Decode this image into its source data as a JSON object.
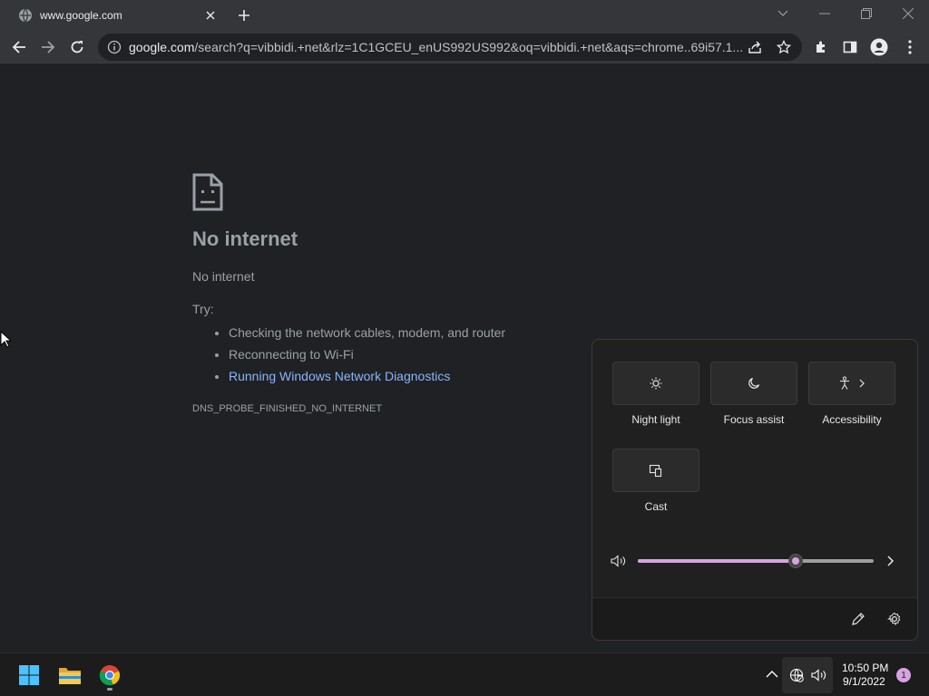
{
  "browser": {
    "tab": {
      "title": "www.google.com"
    },
    "address": {
      "host": "google.com",
      "path": "/search?q=vibbidi.+net&rlz=1C1GCEU_enUS992US992&oq=vibbidi.+net&aqs=chrome..69i57.1..."
    }
  },
  "error_page": {
    "heading": "No internet",
    "subheading": "No internet",
    "try_label": "Try:",
    "suggestions": [
      "Checking the network cables, modem, and router",
      "Reconnecting to Wi-Fi"
    ],
    "link_text": "Running Windows Network Diagnostics",
    "error_code": "DNS_PROBE_FINISHED_NO_INTERNET"
  },
  "quick_settings": {
    "tiles": [
      {
        "label": "Night light",
        "icon": "brightness-icon"
      },
      {
        "label": "Focus assist",
        "icon": "moon-icon"
      },
      {
        "label": "Accessibility",
        "icon": "accessibility-icon"
      },
      {
        "label": "Cast",
        "icon": "cast-icon"
      }
    ],
    "volume_level": 0.67
  },
  "taskbar": {
    "time": "10:50 PM",
    "date": "9/1/2022",
    "notification_count": "1"
  },
  "colors": {
    "accent": "#d7a3e0",
    "link": "#8ab4f8",
    "page_bg": "#202124"
  }
}
